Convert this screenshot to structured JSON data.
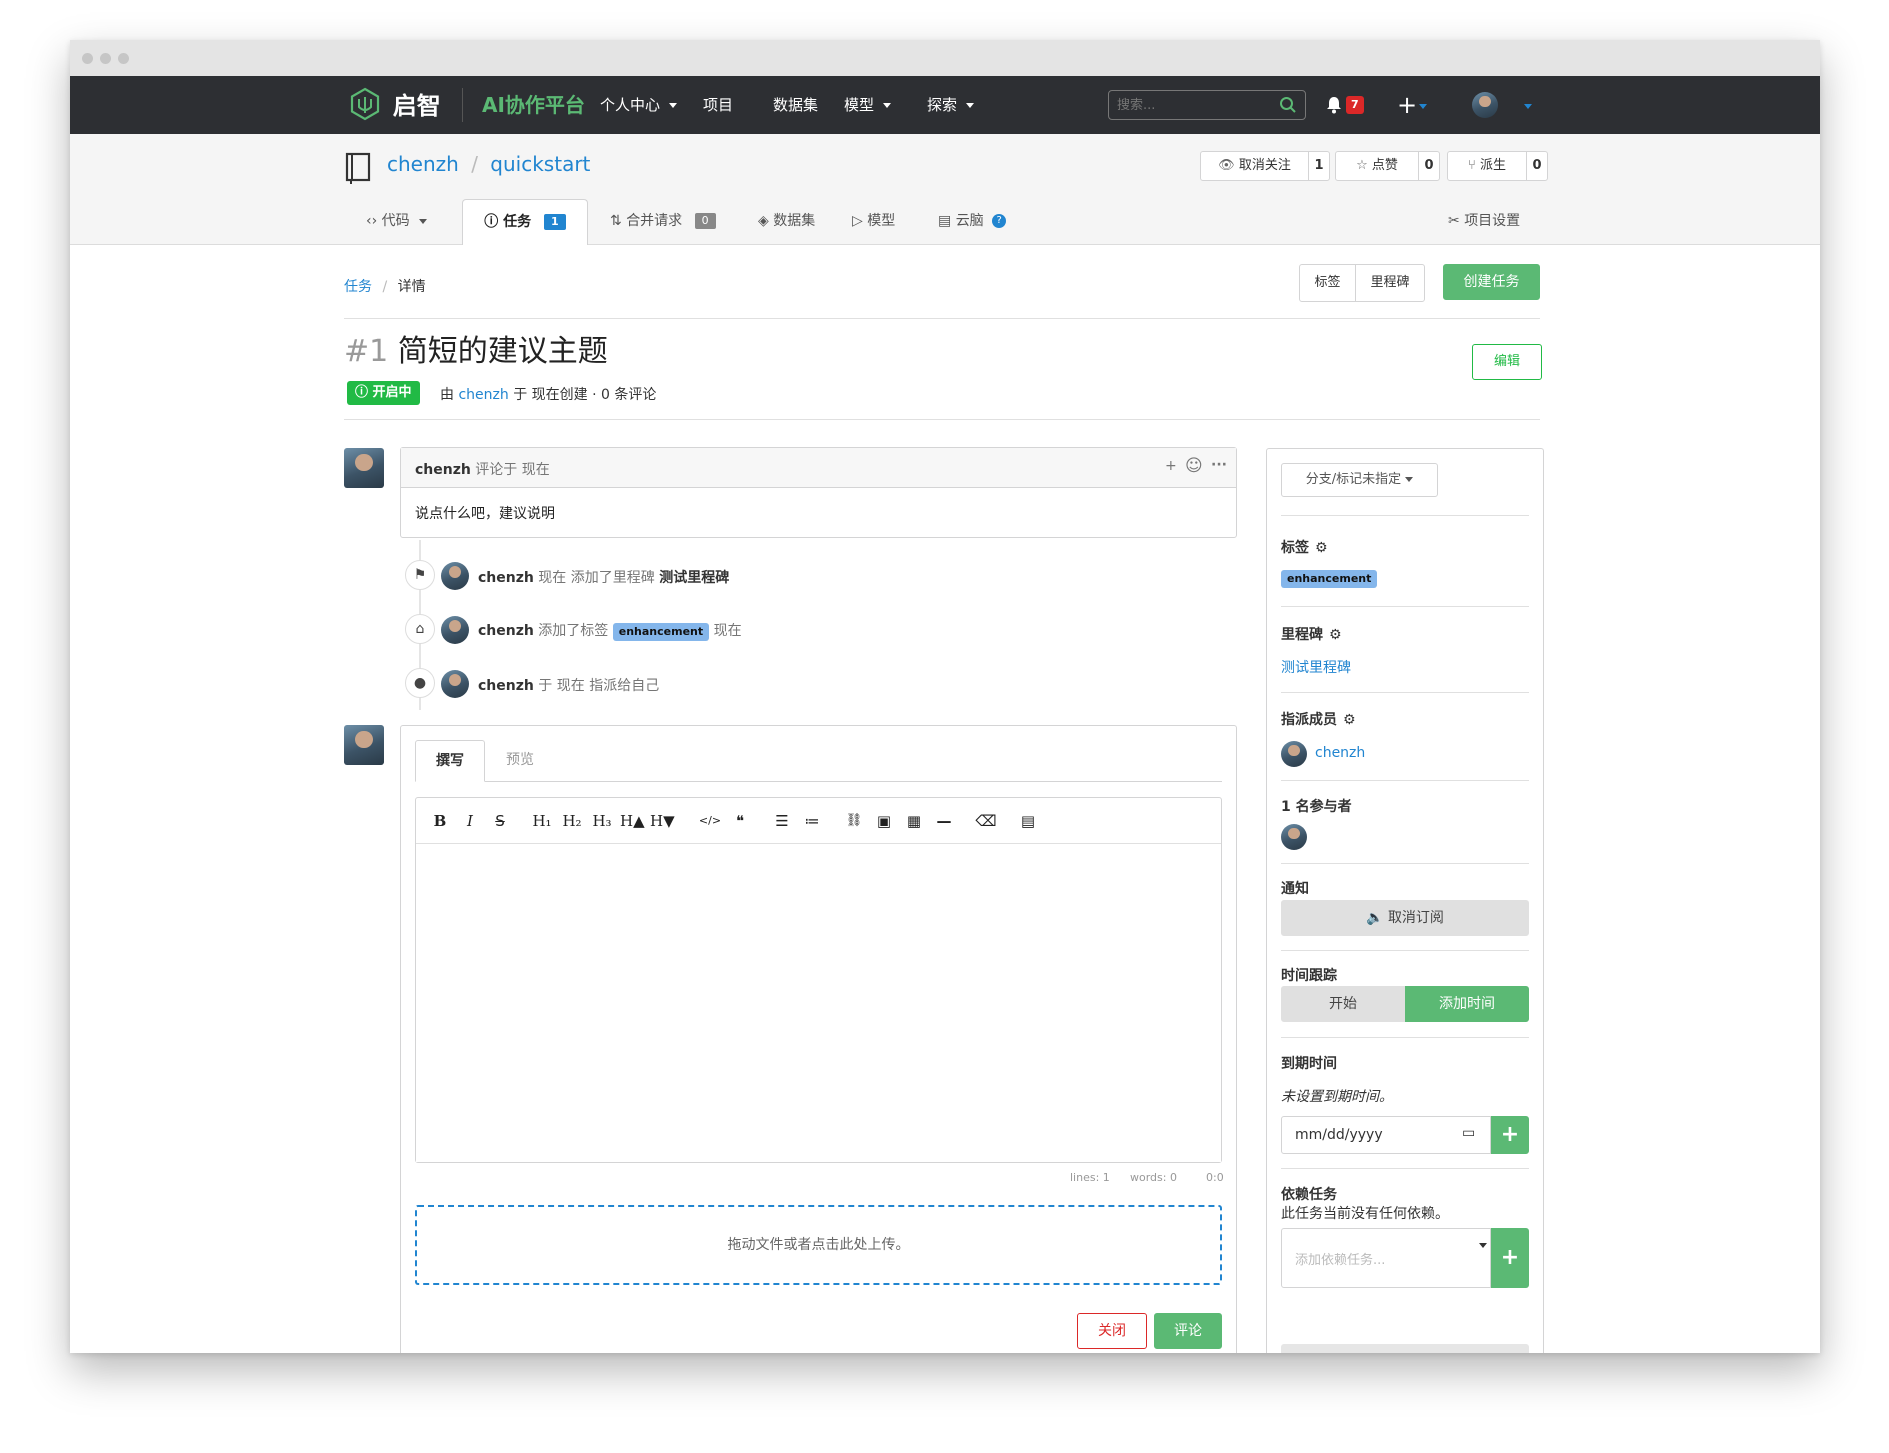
{
  "brand": {
    "logo_text": "启智",
    "platform": "AI协作平台"
  },
  "topnav": {
    "items": [
      "个人中心",
      "项目",
      "数据集",
      "模型",
      "探索"
    ],
    "search_placeholder": "搜索...",
    "notification_count": "7",
    "plus": "+"
  },
  "repo": {
    "owner": "chenzh",
    "sep": "/",
    "name": "quickstart",
    "unwatch_label": "取消关注",
    "unwatch_count": "1",
    "star_label": "点赞",
    "star_count": "0",
    "fork_label": "派生",
    "fork_count": "0"
  },
  "tabs": {
    "code": "代码",
    "issues": "任务",
    "issues_count": "1",
    "pulls": "合并请求",
    "pulls_count": "0",
    "datasets": "数据集",
    "models": "模型",
    "cloudbrain": "云脑",
    "settings": "项目设置"
  },
  "breadcrumb": {
    "root": "任务",
    "sep": "/",
    "current": "详情"
  },
  "actions": {
    "labels": "标签",
    "milestones": "里程碑",
    "new_issue": "创建任务"
  },
  "issue": {
    "number": "#1",
    "title": "简短的建议主题",
    "edit": "编辑",
    "status": "开启中",
    "meta_prefix": "由",
    "meta_author": "chenzh",
    "meta_suffix": "于 现在创建 · 0 条评论"
  },
  "comment": {
    "author": "chenzh",
    "action": "评论于 现在",
    "plus": "+",
    "more": "···",
    "body": "说点什么吧，建议说明"
  },
  "timeline": [
    {
      "icon": "milestone-icon",
      "author": "chenzh",
      "text_pre": "现在 添加了里程碑",
      "strong": "测试里程碑",
      "label": "",
      "text_post": ""
    },
    {
      "icon": "tag-icon",
      "author": "chenzh",
      "text_pre": "添加了标签",
      "strong": "",
      "label": "enhancement",
      "text_post": "现在"
    },
    {
      "icon": "person-icon",
      "author": "chenzh",
      "text_pre": "于 现在 指派给自己",
      "strong": "",
      "label": "",
      "text_post": ""
    }
  ],
  "editor": {
    "tab_write": "撰写",
    "tab_preview": "预览",
    "toolbar": [
      "B",
      "I",
      "S",
      "H₁",
      "H₂",
      "H₃",
      "H▲",
      "H▼",
      "</>",
      "❝",
      "☰",
      "≔",
      "⛓",
      "▣",
      "▦",
      "—",
      "⌫",
      "▤"
    ],
    "status_lines": "lines: 1",
    "status_words": "words: 0",
    "status_pos": "0:0",
    "upload_hint": "拖动文件或者点击此处上传。",
    "close_button": "关闭",
    "comment_button": "评论"
  },
  "sidebar": {
    "branch_dropdown": "分支/标记未指定",
    "labels_title": "标签",
    "label_value": "enhancement",
    "milestone_title": "里程碑",
    "milestone_value": "测试里程碑",
    "assignees_title": "指派成员",
    "assignee": "chenzh",
    "participants_title": "1 名参与者",
    "notify_title": "通知",
    "unsubscribe": "取消订阅",
    "time_title": "时间跟踪",
    "time_start": "开始",
    "time_add": "添加时间",
    "due_title": "到期时间",
    "due_empty": "未设置到期时间。",
    "date_placeholder": "mm/dd/yyyy",
    "deps_title": "依赖任务",
    "deps_empty": "此任务当前没有任何依赖。",
    "deps_placeholder": "添加依赖任务..."
  },
  "colors": {
    "nav_bg": "#2d2f33",
    "brand_green": "#5bb974",
    "primary_green": "#5bb974",
    "link_blue": "#2185d0",
    "danger_red": "#db2828",
    "label_blue": "#84b6eb",
    "badge_blue": "#2185d0"
  }
}
